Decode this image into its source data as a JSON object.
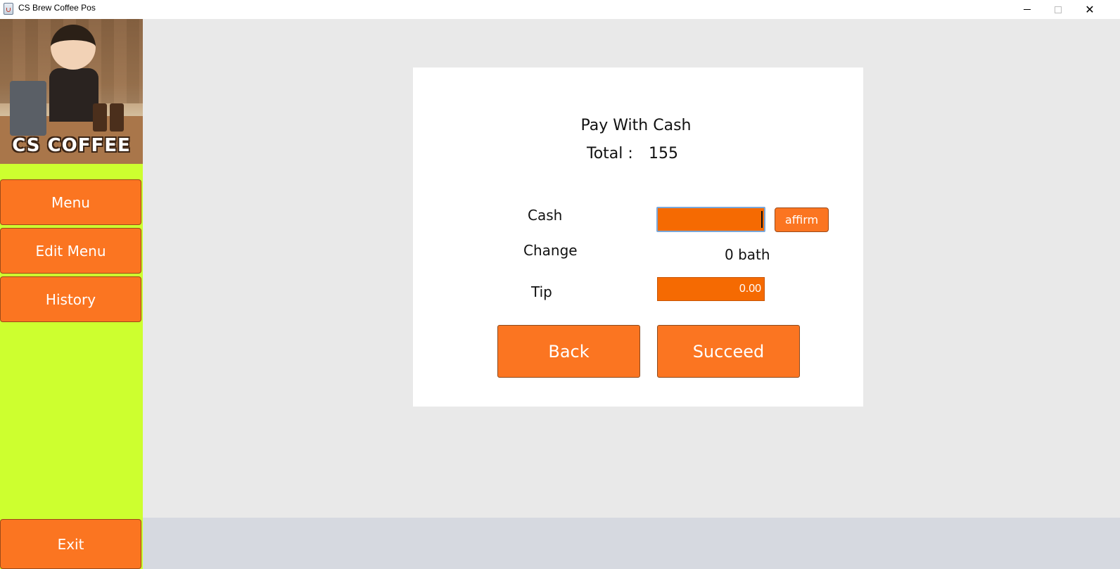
{
  "window": {
    "title": "CS Brew Coffee Pos",
    "controls": {
      "minimize": "minimize-icon",
      "maximize": "maximize-icon",
      "close": "✕"
    }
  },
  "sidebar": {
    "logo_text": "CS COFFEE",
    "items": [
      {
        "label": "Menu"
      },
      {
        "label": "Edit Menu"
      },
      {
        "label": "History"
      }
    ],
    "exit_label": "Exit",
    "background": "#cdff2f",
    "button_color": "#fb7521"
  },
  "payment": {
    "title": "Pay With Cash",
    "total_label": "Total :",
    "total_value": "155",
    "cash_label": "Cash",
    "cash_value": "",
    "affirm_label": "affirm",
    "change_label": "Change",
    "change_value": "0 bath",
    "tip_label": "Tip",
    "tip_value": "0.00",
    "back_label": "Back",
    "succeed_label": "Succeed",
    "input_color": "#f56a02"
  }
}
